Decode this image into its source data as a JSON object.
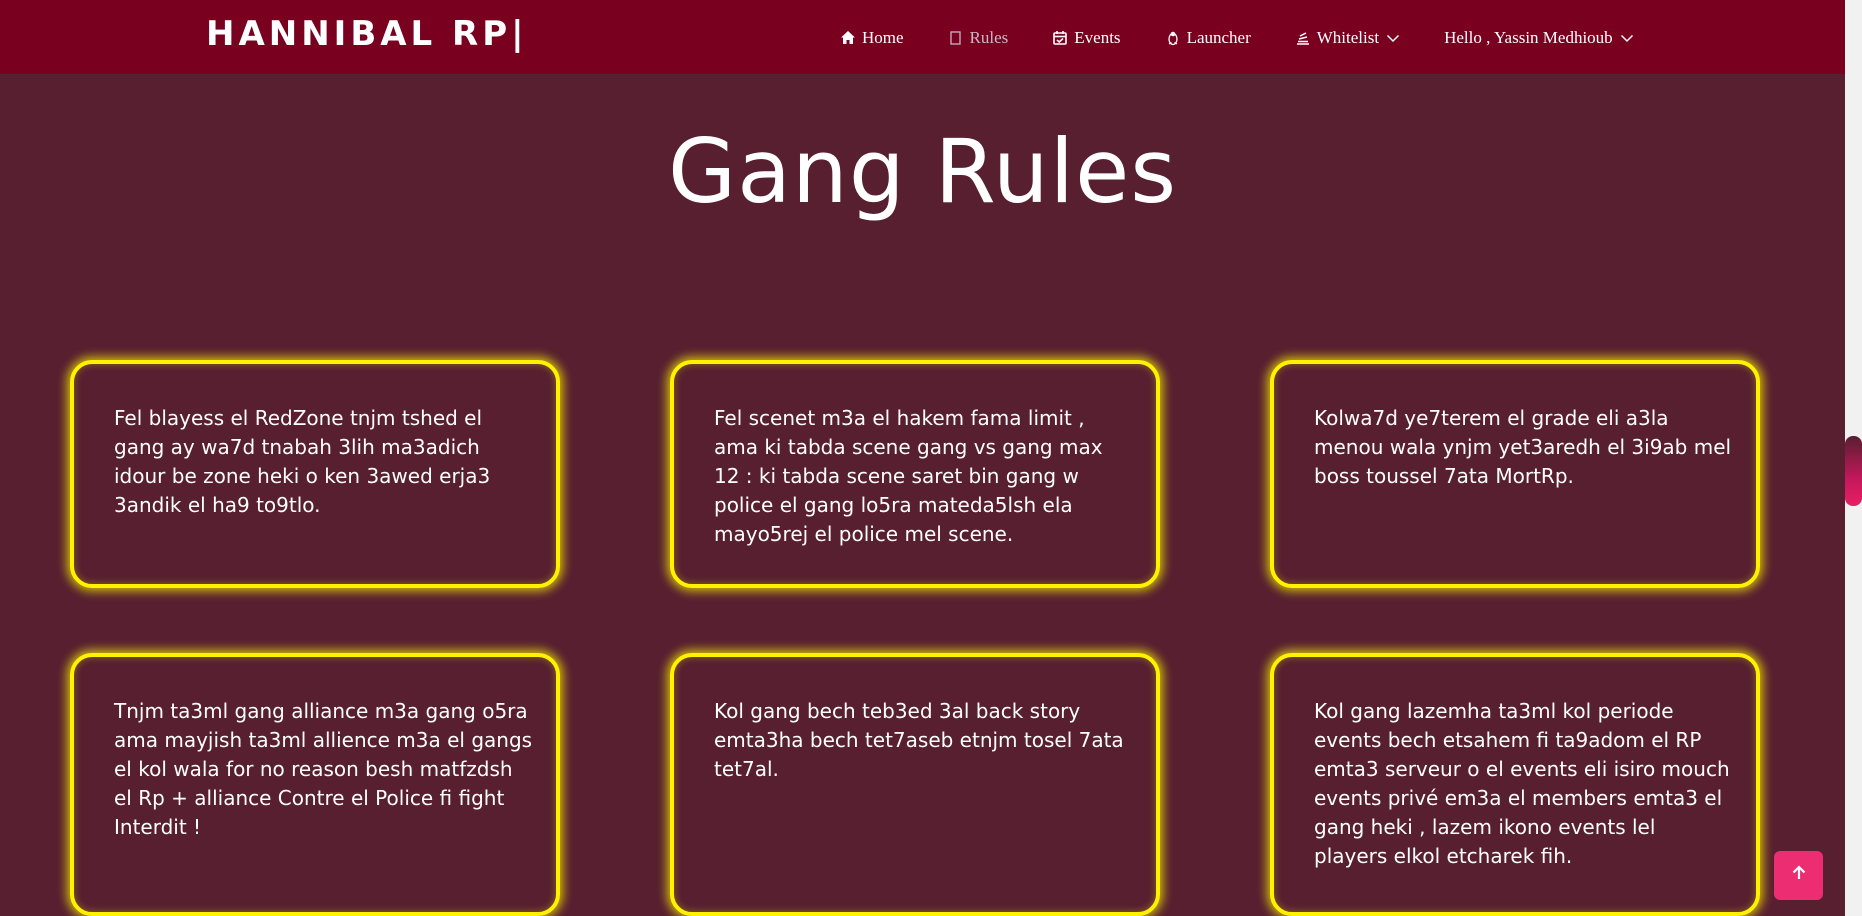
{
  "brand": "HANNIBAL RP|",
  "nav": {
    "home": "Home",
    "rules": "Rules",
    "events": "Events",
    "launcher": "Launcher",
    "whitelist": "Whitelist",
    "user": "Hello , Yassin Medhioub"
  },
  "page_title": "Gang Rules",
  "rules": [
    "Fel blayess el RedZone tnjm tshed el gang ay wa7d tnabah 3lih ma3adich idour be zone heki o ken 3awed erja3 3andik el ha9 to9tlo.",
    "Fel scenet m3a el hakem fama limit , ama ki tabda scene gang vs gang max 12 : ki tabda scene saret bin gang w police el gang lo5ra mateda5lsh ela mayo5rej el police mel scene.",
    "Kolwa7d ye7terem el grade eli a3la menou wala ynjm yet3aredh el 3i9ab mel boss toussel 7ata MortRp.",
    "Tnjm ta3ml gang alliance m3a gang o5ra ama mayjish ta3ml allience m3a el gangs el kol wala for no reason besh matfzdsh el Rp + alliance Contre el Police fi fight Interdit !",
    "Kol gang bech teb3ed 3al back story emta3ha bech tet7aseb etnjm tosel 7ata tet7al.",
    "Kol gang lazemha ta3ml kol periode events bech etsahem fi ta9adom el RP emta3 serveur o el events eli isiro mouch events privé em3a el members emta3 el gang heki , lazem ikono events lel players elkol etcharek fih."
  ],
  "colors": {
    "navbar": "#7a0020",
    "background": "#571f30",
    "card_border": "#fff200",
    "back_to_top": "#ec2d72"
  }
}
